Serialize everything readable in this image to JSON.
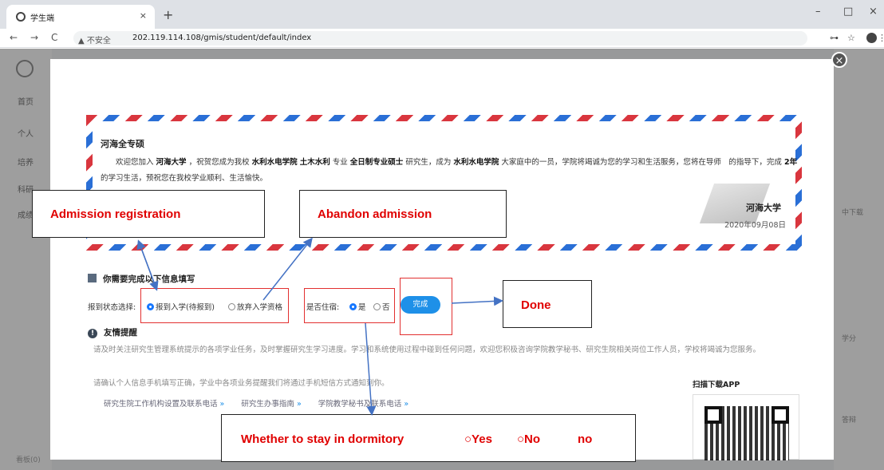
{
  "browser": {
    "tab_title": "学生端",
    "tab_close": "×",
    "new_tab": "+",
    "win_min": "–",
    "win_max": "□",
    "win_close": "×",
    "back": "←",
    "forward": "→",
    "reload": "C",
    "security_label": "▲ 不安全",
    "url": "202.119.114.108/gmis/student/default/index",
    "key_icon": "⊶",
    "star_icon": "☆",
    "menu_icon": "⋮"
  },
  "app": {
    "side_items": [
      "首页",
      "个人",
      "培养",
      "科研",
      "成绩"
    ],
    "side_footer": "看板(0)",
    "right_texts": [
      "中下载",
      "学分",
      "答辩"
    ]
  },
  "letter": {
    "title": "河海全专硕",
    "para_1": "欢迎您加入",
    "university": "河海大学",
    "para_2": "，祝贺您成为我校",
    "college": "水利水电学院",
    "major": "土木水利",
    "para_3": "专业",
    "degree_type": "全日制专业硕士",
    "para_4": "研究生，成为",
    "college_2": "水利水电学院",
    "para_5": "大家庭中的一员，学院将竭诚为您的学习和生活服务，您将在导师　的指导下，完成",
    "years": "2年",
    "para_6": "的学习生活，预祝您在我校学业顺利、生活愉快。",
    "signature": "河海大学",
    "date": "2020年09月08日"
  },
  "form": {
    "section_title": "你需要完成以下信息填写",
    "report_label": "报到状态选择:",
    "report_options": [
      "报到入学(待报到)",
      "放弃入学资格"
    ],
    "report_selected": 0,
    "dorm_label": "是否住宿:",
    "dorm_options": [
      "是",
      "否"
    ],
    "dorm_selected": 0,
    "submit_label": "完成"
  },
  "tips": {
    "title": "友情提醒",
    "line_1": "请及时关注研究生管理系统提示的各项学业任务，及时掌握研究生学习进度。学习和系统使用过程中碰到任何问题，欢迎您积极咨询学院教学秘书、研究生院相关岗位工作人员，学校将竭诚为您服务。",
    "line_2": "请确认个人信息手机填写正确，学业中各项业务提醒我们将通过手机短信方式通知到你。",
    "links": [
      "研究生院工作机构设置及联系电话",
      "研究生办事指南",
      "学院教学秘书及联系电话"
    ],
    "link_chev": "»",
    "qr_title": "扫描下载APP"
  },
  "annotations": {
    "admission": "Admission registration",
    "abandon": "Abandon admission",
    "done": "Done",
    "dorm_text": "Whether to stay in dormitory",
    "dorm_yes": "○Yes",
    "dorm_no": "○No",
    "dorm_tail": "no",
    "color": "#e00000"
  }
}
